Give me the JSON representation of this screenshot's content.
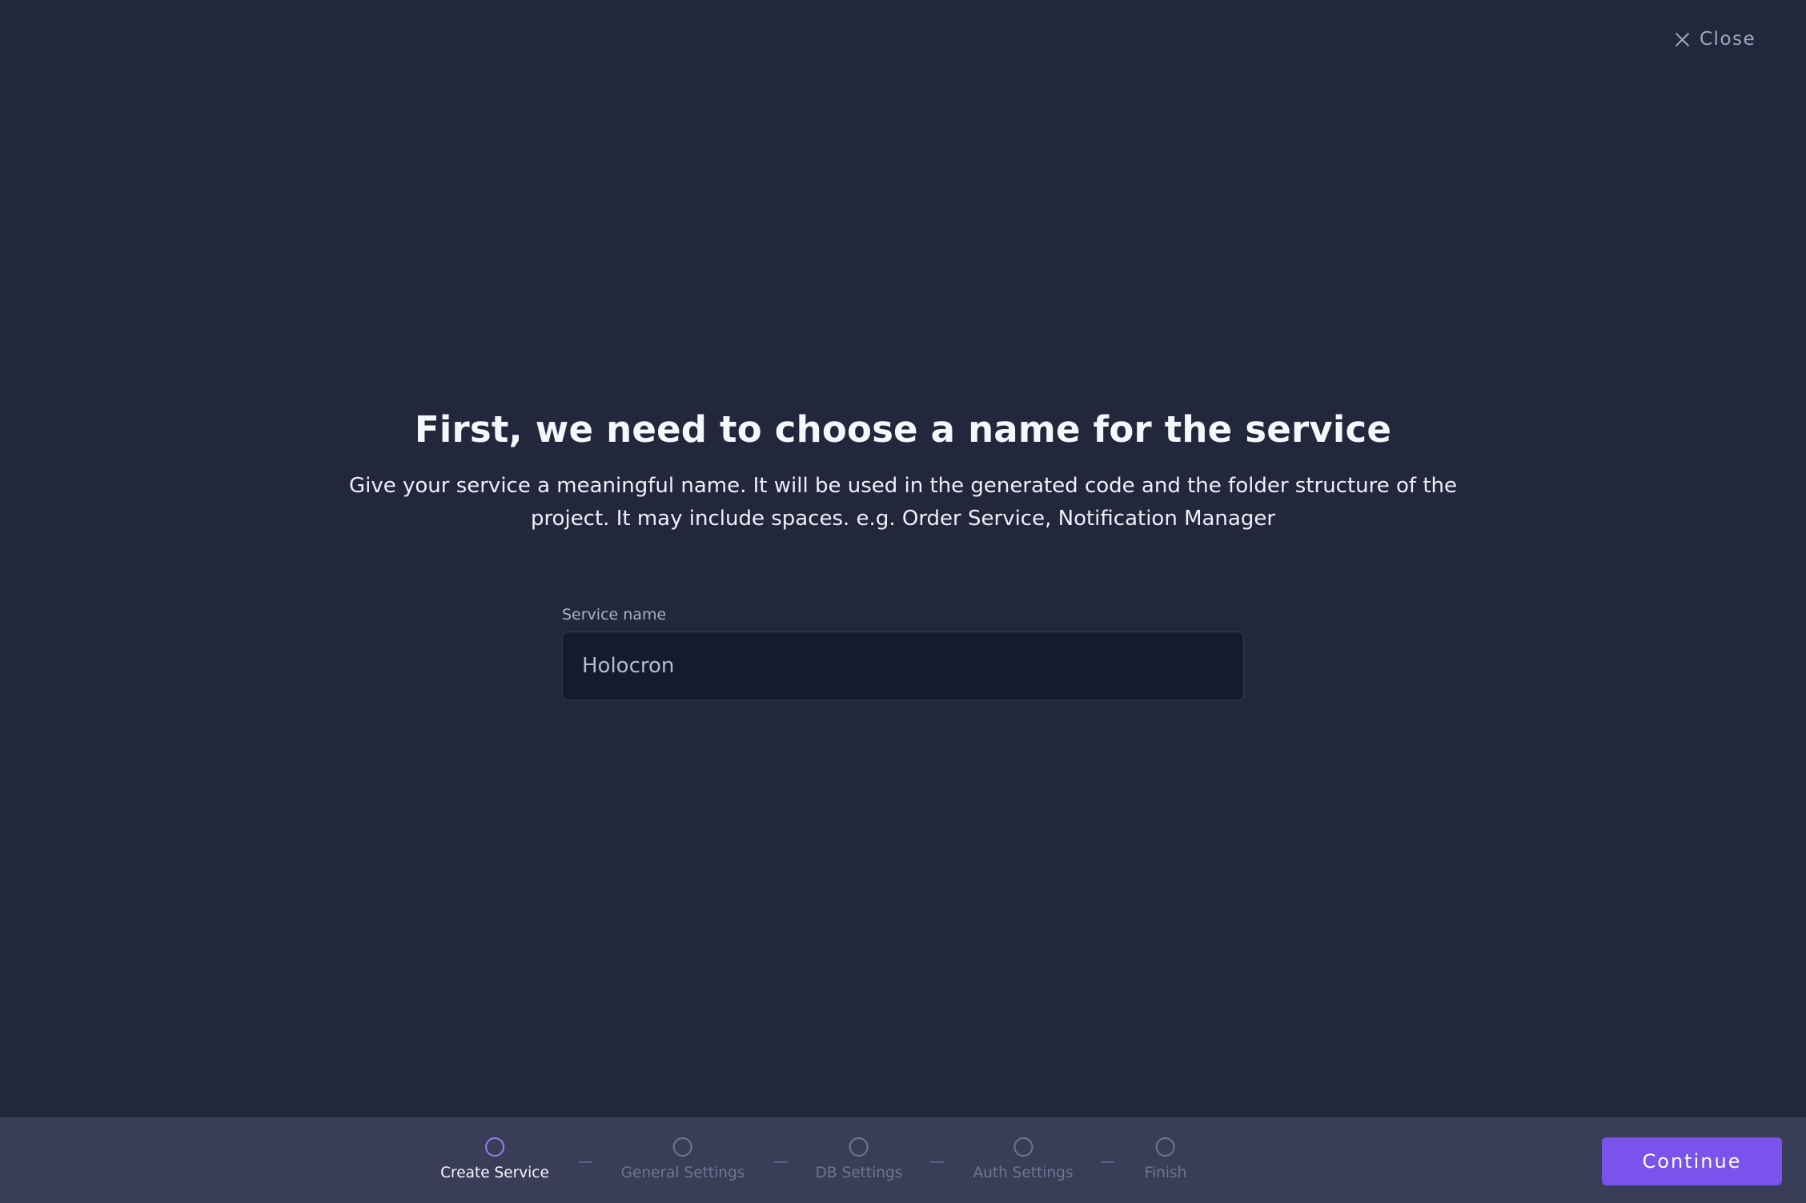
{
  "header": {
    "close_label": "Close",
    "close_icon": "close-icon"
  },
  "main": {
    "title": "First, we need to choose a name for the service",
    "subtitle": "Give your service a meaningful name. It will be used in the generated code and the folder structure of the project. It may include spaces. e.g. Order Service, Notification Manager"
  },
  "form": {
    "service_name": {
      "label": "Service name",
      "value": "Holocron"
    }
  },
  "footer": {
    "steps": [
      {
        "label": "Create Service",
        "active": true
      },
      {
        "label": "General Settings",
        "active": false
      },
      {
        "label": "DB Settings",
        "active": false
      },
      {
        "label": "Auth Settings",
        "active": false
      },
      {
        "label": "Finish",
        "active": false
      }
    ],
    "continue_label": "Continue"
  },
  "colors": {
    "background": "#23273b",
    "footer": "#3a3d57",
    "accent": "#7a52ec",
    "active_step": "#9c7cf2",
    "inactive_step": "#6f7592",
    "input_background": "#161a2d"
  }
}
